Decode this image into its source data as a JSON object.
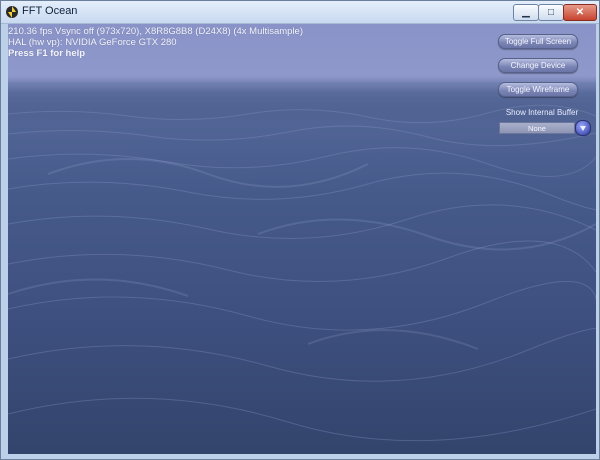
{
  "window": {
    "title": "FFT Ocean",
    "controls": {
      "minimize": "▁",
      "maximize": "□",
      "close": "✕"
    }
  },
  "hud": {
    "stats_line": "210.36 fps Vsync off (973x720), X8R8G8B8 (D24X8) (4x Multisample)",
    "device_line": "HAL (hw vp): NVIDIA GeForce GTX 280",
    "help_line": "Press F1 for help"
  },
  "controls_panel": {
    "toggle_fullscreen": "Toggle Full Screen",
    "change_device": "Change Device",
    "toggle_wireframe": "Toggle Wireframe",
    "buffer_label": "Show Internal Buffer",
    "buffer_value": "None"
  },
  "colors": {
    "sky": "#8a93c8",
    "ocean": "#3d4f7e",
    "button": "#7a84b4",
    "dropdown_arrow": "#4b58b8"
  },
  "icons": {
    "app": "ocean-app-icon",
    "dropdown": "chevron-down-icon"
  }
}
